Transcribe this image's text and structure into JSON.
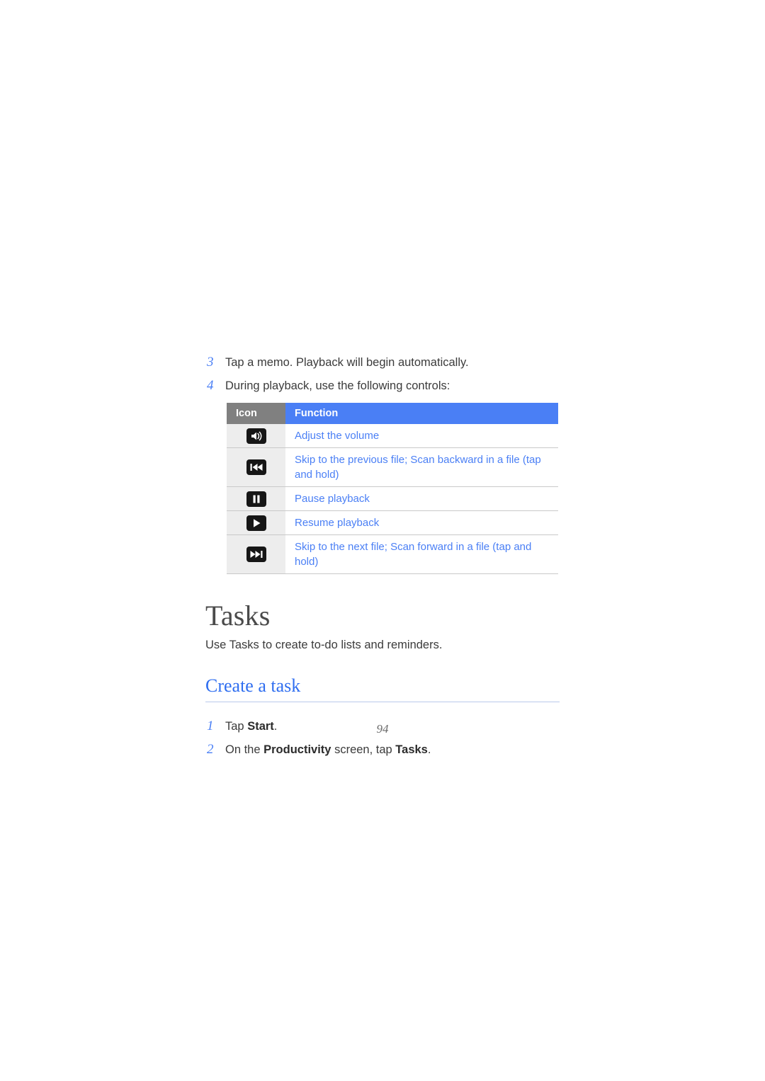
{
  "document": {
    "page_number": "94"
  },
  "steps_top": [
    {
      "num": "3",
      "text": "Tap a memo. Playback will begin automatically."
    },
    {
      "num": "4",
      "text": "During playback, use the following controls:"
    }
  ],
  "controls_table": {
    "headers": {
      "icon": "Icon",
      "function": "Function"
    },
    "rows": [
      {
        "icon": "volume-icon",
        "function": "Adjust the volume"
      },
      {
        "icon": "skip-backward-icon",
        "function": "Skip to the previous file; Scan backward in a file (tap and hold)"
      },
      {
        "icon": "pause-icon",
        "function": "Pause playback"
      },
      {
        "icon": "play-icon",
        "function": "Resume playback"
      },
      {
        "icon": "skip-forward-icon",
        "function": "Skip to the next file; Scan forward in a file (tap and hold)"
      }
    ]
  },
  "tasks_section": {
    "heading": "Tasks",
    "intro": "Use Tasks to create to-do lists and reminders.",
    "subheading": "Create a task",
    "steps": [
      {
        "num": "1",
        "pre": "Tap ",
        "bold": "Start",
        "post": "."
      },
      {
        "num": "2",
        "pre": "On the ",
        "bold": "Productivity",
        "mid": " screen, tap ",
        "bold2": "Tasks",
        "post": "."
      }
    ]
  },
  "colors": {
    "accent_blue": "#4a7ff5",
    "header_gray": "#808080",
    "icon_cell_bg": "#ededed",
    "body_text": "#3b3b3b",
    "heading_gray": "#4a4a4a",
    "link_blue": "#2f6ef0"
  }
}
